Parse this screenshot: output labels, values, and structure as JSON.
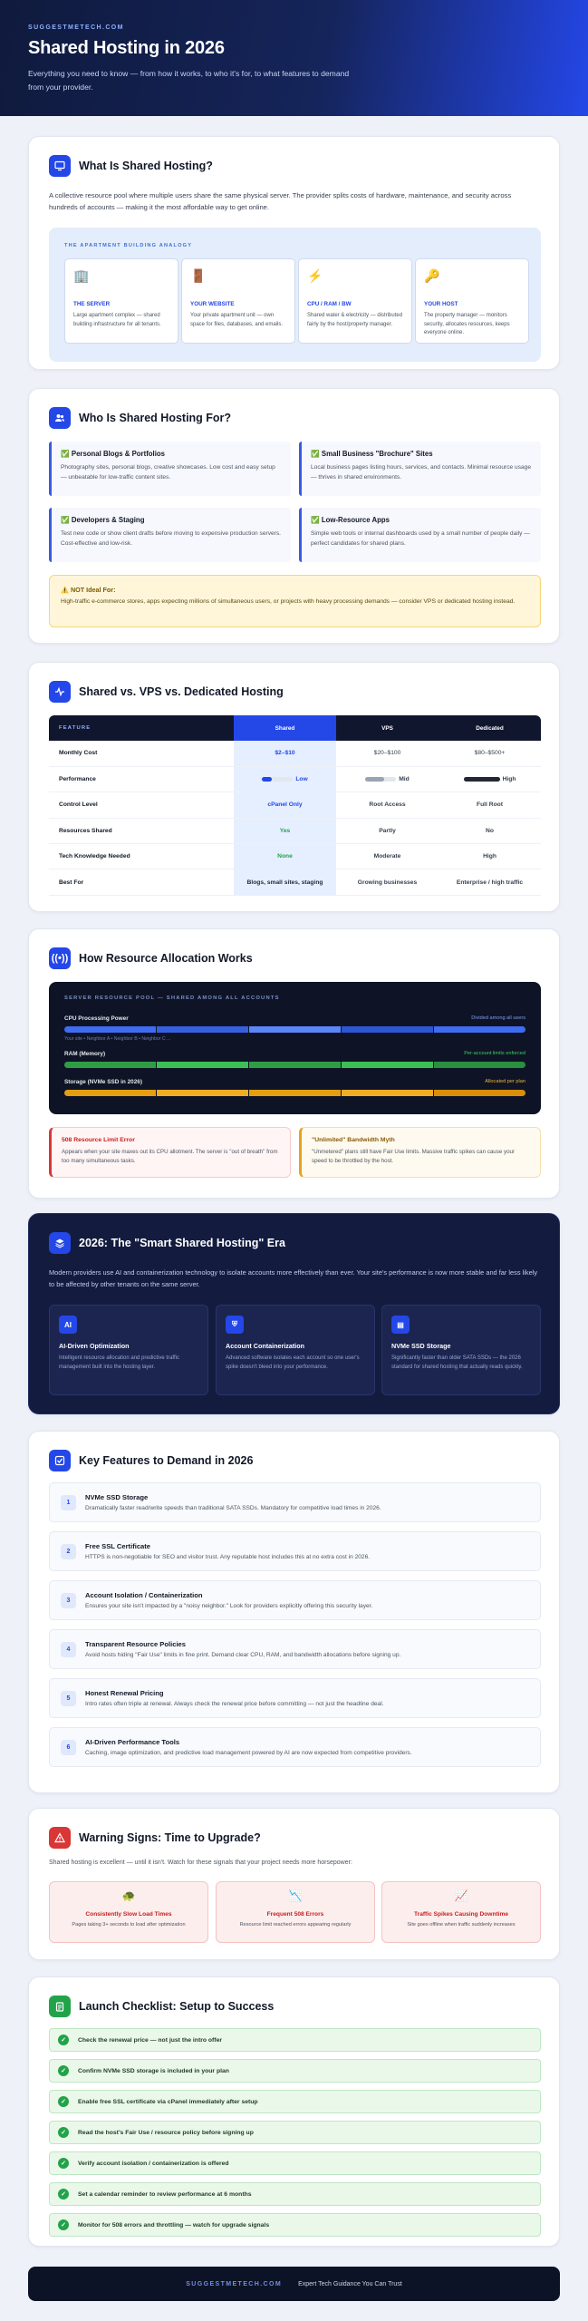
{
  "hero": {
    "brand": "SUGGESTMETECH.COM",
    "title": "Shared Hosting in 2026",
    "subtitle": "Everything you need to know — from how it works, to who it's for, to what features to demand from your provider."
  },
  "what": {
    "title": "What Is Shared Hosting?",
    "icon": "monitor-icon",
    "intro": "A collective resource pool where multiple users share the same physical server. The provider splits costs of hardware, maintenance, and security across hundreds of accounts — making it the most affordable way to get online.",
    "analogy_label": "THE APARTMENT BUILDING ANALOGY",
    "tiles": [
      {
        "icon": "🏢",
        "title": "THE SERVER",
        "desc": "Large apartment complex — shared building infrastructure for all tenants."
      },
      {
        "icon": "🚪",
        "title": "YOUR WEBSITE",
        "desc": "Your private apartment unit — own space for files, databases, and emails."
      },
      {
        "icon": "⚡",
        "title": "CPU / RAM / BW",
        "desc": "Shared water & electricity — distributed fairly by the host/property manager."
      },
      {
        "icon": "🔑",
        "title": "YOUR HOST",
        "desc": "The property manager — monitors security, allocates resources, keeps everyone online."
      }
    ]
  },
  "who": {
    "title": "Who Is Shared Hosting For?",
    "items": [
      {
        "title": "✅ Personal Blogs & Portfolios",
        "desc": "Photography sites, personal blogs, creative showcases. Low cost and easy setup — unbeatable for low-traffic content sites."
      },
      {
        "title": "✅ Small Business \"Brochure\" Sites",
        "desc": "Local business pages listing hours, services, and contacts. Minimal resource usage — thrives in shared environments."
      },
      {
        "title": "✅ Developers & Staging",
        "desc": "Test new code or show client drafts before moving to expensive production servers. Cost-effective and low-risk."
      },
      {
        "title": "✅ Low-Resource Apps",
        "desc": "Simple web tools or internal dashboards used by a small number of people daily — perfect candidates for shared plans."
      }
    ],
    "warn_title": "⚠️ NOT Ideal For:",
    "warn_desc": "High-traffic e-commerce stores, apps expecting millions of simultaneous users, or projects with heavy processing demands — consider VPS or dedicated hosting instead."
  },
  "compare": {
    "title": "Shared vs. VPS vs. Dedicated Hosting",
    "headers": [
      "FEATURE",
      "Shared",
      "VPS",
      "Dedicated"
    ],
    "rows": [
      {
        "feature": "Monthly Cost",
        "shared": "$2–$10",
        "vps": "$20–$100",
        "dedicated": "$80–$500+"
      },
      {
        "feature": "Performance",
        "shared": "Low",
        "vps": "Mid",
        "dedicated": "High"
      },
      {
        "feature": "Control Level",
        "shared": "cPanel Only",
        "vps": "Root Access",
        "dedicated": "Full Root"
      },
      {
        "feature": "Resources Shared",
        "shared": "Yes",
        "vps": "Partly",
        "dedicated": "No"
      },
      {
        "feature": "Tech Knowledge Needed",
        "shared": "None",
        "vps": "Moderate",
        "dedicated": "High"
      },
      {
        "feature": "Best For",
        "shared": "Blogs, small sites, staging",
        "vps": "Growing businesses",
        "dedicated": "Enterprise / high traffic"
      }
    ],
    "performance_levels": {
      "shared": 0.3,
      "vps": 0.6,
      "dedicated": 1.0
    }
  },
  "alloc": {
    "title": "How Resource Allocation Works",
    "pool_label": "SERVER RESOURCE POOL — SHARED AMONG ALL ACCOUNTS",
    "rows": [
      {
        "name": "CPU Processing Power",
        "right": "Divided among all users",
        "color": "#3f6cf0",
        "note": "Your site  • Neighbor A  • Neighbor B  • Neighbor C ..."
      },
      {
        "name": "RAM (Memory)",
        "right": "Per-account limits enforced",
        "color": "#31b94a",
        "note": ""
      },
      {
        "name": "Storage (NVMe SSD in 2026)",
        "right": "Allocated per plan",
        "color": "#f0a51a",
        "note": ""
      }
    ],
    "alert1_title": "508 Resource Limit Error",
    "alert1_desc": "Appears when your site maxes out its CPU allotment. The server is \"out of breath\" from too many simultaneous tasks.",
    "alert2_title": "\"Unlimited\" Bandwidth Myth",
    "alert2_desc": "\"Unmetered\" plans still have Fair Use limits. Massive traffic spikes can cause your speed to be throttled by the host."
  },
  "era": {
    "title": "2026: The \"Smart Shared Hosting\" Era",
    "intro": "Modern providers use AI and containerization technology to isolate accounts more effectively than ever. Your site's performance is now more stable and far less likely to be affected by other tenants on the same server.",
    "tiles": [
      {
        "icon": "AI",
        "title": "AI-Driven Optimization",
        "desc": "Intelligent resource allocation and predictive traffic management built into the hosting layer."
      },
      {
        "icon": "⛨",
        "title": "Account Containerization",
        "desc": "Advanced software isolates each account so one user's spike doesn't bleed into your performance."
      },
      {
        "icon": "▤",
        "title": "NVMe SSD Storage",
        "desc": "Significantly faster than older SATA SSDs — the 2026 standard for shared hosting that actually reads quickly."
      }
    ]
  },
  "features": {
    "title": "Key Features to Demand in 2026",
    "items": [
      {
        "num": "1",
        "title": "NVMe SSD Storage",
        "desc": "Dramatically faster read/write speeds than traditional SATA SSDs. Mandatory for competitive load times in 2026."
      },
      {
        "num": "2",
        "title": "Free SSL Certificate",
        "desc": "HTTPS is non-negotiable for SEO and visitor trust. Any reputable host includes this at no extra cost in 2026."
      },
      {
        "num": "3",
        "title": "Account Isolation / Containerization",
        "desc": "Ensures your site isn't impacted by a \"noisy neighbor.\" Look for providers explicitly offering this security layer."
      },
      {
        "num": "4",
        "title": "Transparent Resource Policies",
        "desc": "Avoid hosts hiding \"Fair Use\" limits in fine print. Demand clear CPU, RAM, and bandwidth allocations before signing up."
      },
      {
        "num": "5",
        "title": "Honest Renewal Pricing",
        "desc": "Intro rates often triple at renewal. Always check the renewal price before committing — not just the headline deal."
      },
      {
        "num": "6",
        "title": "AI-Driven Performance Tools",
        "desc": "Caching, image optimization, and predictive load management powered by AI are now expected from competitive providers."
      }
    ]
  },
  "signs": {
    "title": "Warning Signs: Time to Upgrade?",
    "intro": "Shared hosting is excellent — until it isn't. Watch for these signals that your project needs more horsepower:",
    "items": [
      {
        "icon": "🐢",
        "title": "Consistently Slow Load Times",
        "desc": "Pages taking 3+ seconds to load after optimization"
      },
      {
        "icon": "📉",
        "title": "Frequent 508 Errors",
        "desc": "Resource limit reached errors appearing regularly"
      },
      {
        "icon": "📈",
        "title": "Traffic Spikes Causing Downtime",
        "desc": "Site goes offline when traffic suddenly increases"
      }
    ]
  },
  "checklist": {
    "title": "Launch Checklist: Setup to Success",
    "items": [
      "Check the renewal price — not just the intro offer",
      "Confirm NVMe SSD storage is included in your plan",
      "Enable free SSL certificate via cPanel immediately after setup",
      "Read the host's Fair Use / resource policy before signing up",
      "Verify account isolation / containerization is offered",
      "Set a calendar reminder to review performance at 6 months",
      "Monitor for 508 errors and throttling — watch for upgrade signals"
    ]
  },
  "footer": {
    "brand": "SUGGESTMETECH.COM",
    "tagline": "Expert Tech Guidance You Can Trust"
  },
  "colors": {
    "accent": "#2447e8",
    "dark": "#10162e",
    "success": "#22a34a",
    "danger": "#c81e1e"
  }
}
